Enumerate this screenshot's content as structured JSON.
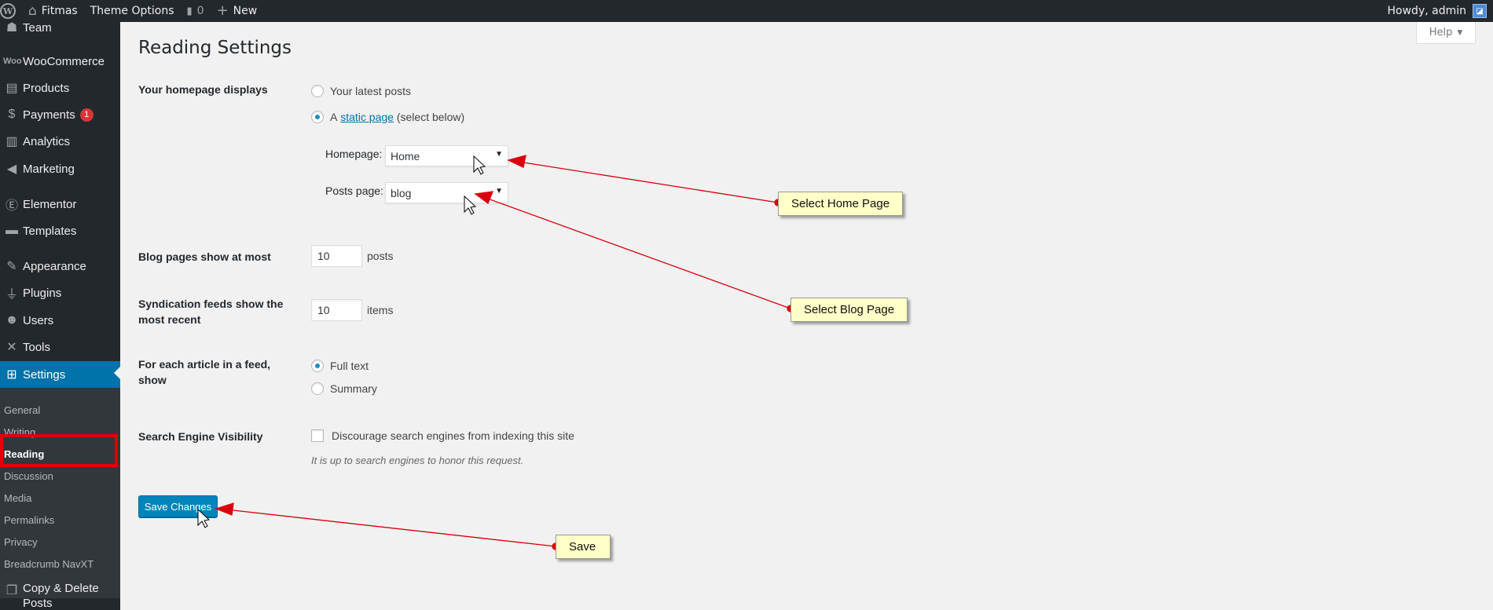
{
  "adminbar": {
    "site_name": "Fitmas",
    "theme_options": "Theme Options",
    "comments_count": "0",
    "new_label": "New",
    "howdy": "Howdy, admin"
  },
  "sidebar": {
    "items": [
      {
        "label": "Team",
        "icon": "team-icon"
      },
      {
        "label": "WooCommerce",
        "icon": "woocommerce-icon"
      },
      {
        "label": "Products",
        "icon": "archive-icon"
      },
      {
        "label": "Payments",
        "icon": "dollar-icon",
        "badge": "1"
      },
      {
        "label": "Analytics",
        "icon": "chart-bar-icon"
      },
      {
        "label": "Marketing",
        "icon": "megaphone-icon"
      },
      {
        "label": "Elementor",
        "icon": "elementor-icon"
      },
      {
        "label": "Templates",
        "icon": "folder-icon"
      },
      {
        "label": "Appearance",
        "icon": "paintbrush-icon"
      },
      {
        "label": "Plugins",
        "icon": "plugin-icon"
      },
      {
        "label": "Users",
        "icon": "users-icon"
      },
      {
        "label": "Tools",
        "icon": "wrench-icon"
      },
      {
        "label": "Settings",
        "icon": "settings-icon"
      }
    ],
    "submenu": [
      "General",
      "Writing",
      "Reading",
      "Discussion",
      "Media",
      "Permalinks",
      "Privacy",
      "Breadcrumb NavXT"
    ],
    "copy_delete": [
      "Copy & Delete",
      "Posts"
    ]
  },
  "main": {
    "help_label": "Help",
    "title": "Reading Settings",
    "homepage_displays": {
      "label": "Your homepage displays",
      "option_latest": "Your latest posts",
      "option_static_prefix": "A",
      "option_static_link": "static page",
      "option_static_suffix": "(select below)",
      "homepage_label": "Homepage:",
      "homepage_value": "Home",
      "posts_page_label": "Posts page:",
      "posts_page_value": "blog"
    },
    "blog_pages": {
      "label": "Blog pages show at most",
      "value": "10",
      "unit": "posts"
    },
    "syndication": {
      "label": "Syndication feeds show the most recent",
      "value": "10",
      "unit": "items"
    },
    "feed_article": {
      "label": "For each article in a feed, show",
      "option_full": "Full text",
      "option_summary": "Summary"
    },
    "search_visibility": {
      "label": "Search Engine Visibility",
      "checkbox_label": "Discourage search engines from indexing this site",
      "description": "It is up to search engines to honor this request."
    },
    "save_label": "Save Changes"
  },
  "annotations": {
    "home": "Select Home Page",
    "blog": "Select Blog Page",
    "save": "Save"
  },
  "colors": {
    "admin_dark": "#23282d",
    "accent": "#0073aa",
    "annotation_bg": "#ffffc8",
    "arrow_red": "#d9000d"
  }
}
